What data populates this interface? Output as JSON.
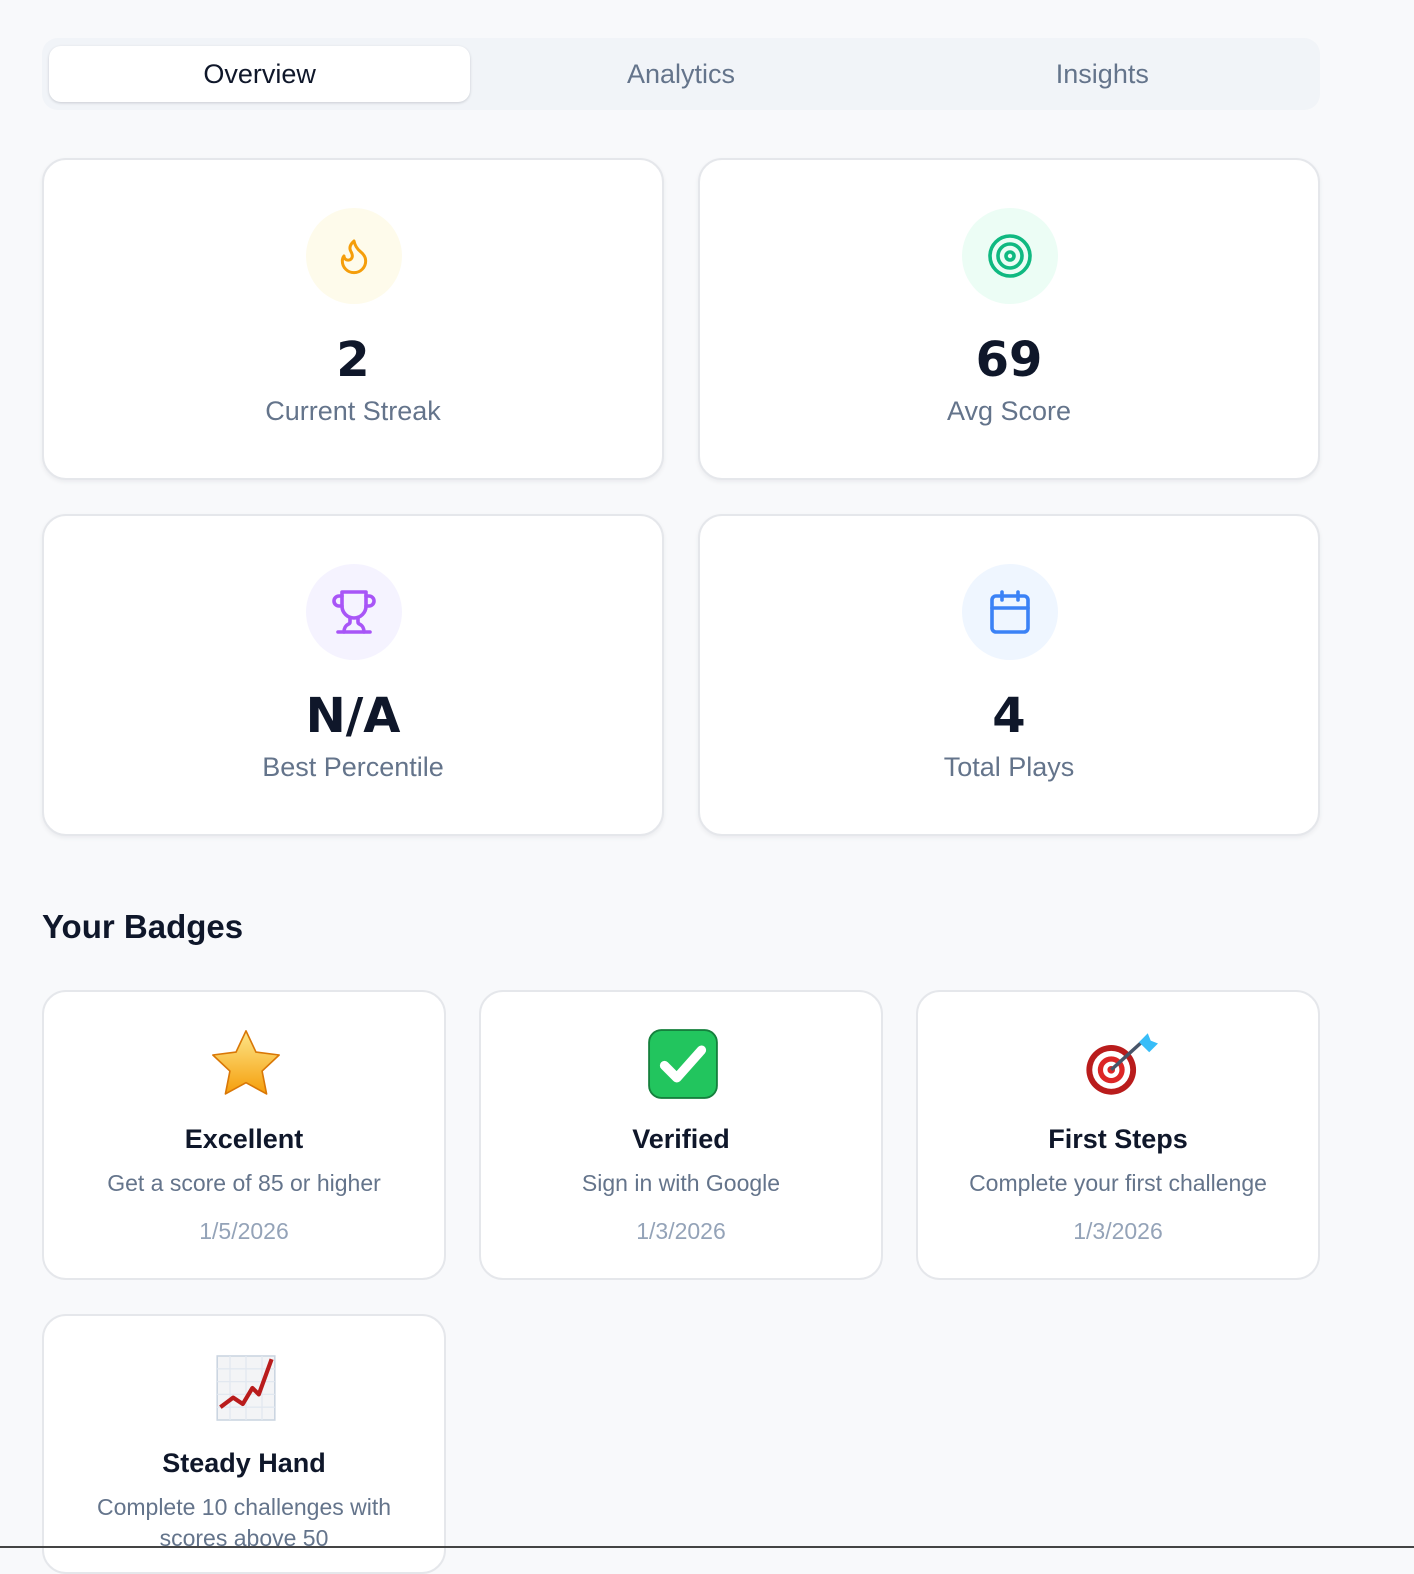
{
  "tabs": [
    {
      "label": "Overview",
      "active": true
    },
    {
      "label": "Analytics",
      "active": false
    },
    {
      "label": "Insights",
      "active": false
    }
  ],
  "stats": [
    {
      "value": "2",
      "label": "Current Streak",
      "icon": "flame-icon",
      "icon_color": "#f59e0b",
      "icon_bg": "#fefbeb"
    },
    {
      "value": "69",
      "label": "Avg Score",
      "icon": "target-icon",
      "icon_color": "#10b981",
      "icon_bg": "#ecfdf5"
    },
    {
      "value": "N/A",
      "label": "Best Percentile",
      "icon": "trophy-icon",
      "icon_color": "#a855f7",
      "icon_bg": "#f5f3ff"
    },
    {
      "value": "4",
      "label": "Total Plays",
      "icon": "calendar-icon",
      "icon_color": "#3b82f6",
      "icon_bg": "#eff6ff"
    }
  ],
  "badges_section": {
    "title": "Your Badges",
    "items": [
      {
        "icon": "star-icon",
        "title": "Excellent",
        "description": "Get a score of 85 or higher",
        "date": "1/5/2026"
      },
      {
        "icon": "check-mark-icon",
        "title": "Verified",
        "description": "Sign in with Google",
        "date": "1/3/2026"
      },
      {
        "icon": "dart-target-icon",
        "title": "First Steps",
        "description": "Complete your first challenge",
        "date": "1/3/2026"
      },
      {
        "icon": "chart-increasing-icon",
        "title": "Steady Hand",
        "description": "Complete 10 challenges with scores above 50",
        "date": ""
      }
    ]
  }
}
